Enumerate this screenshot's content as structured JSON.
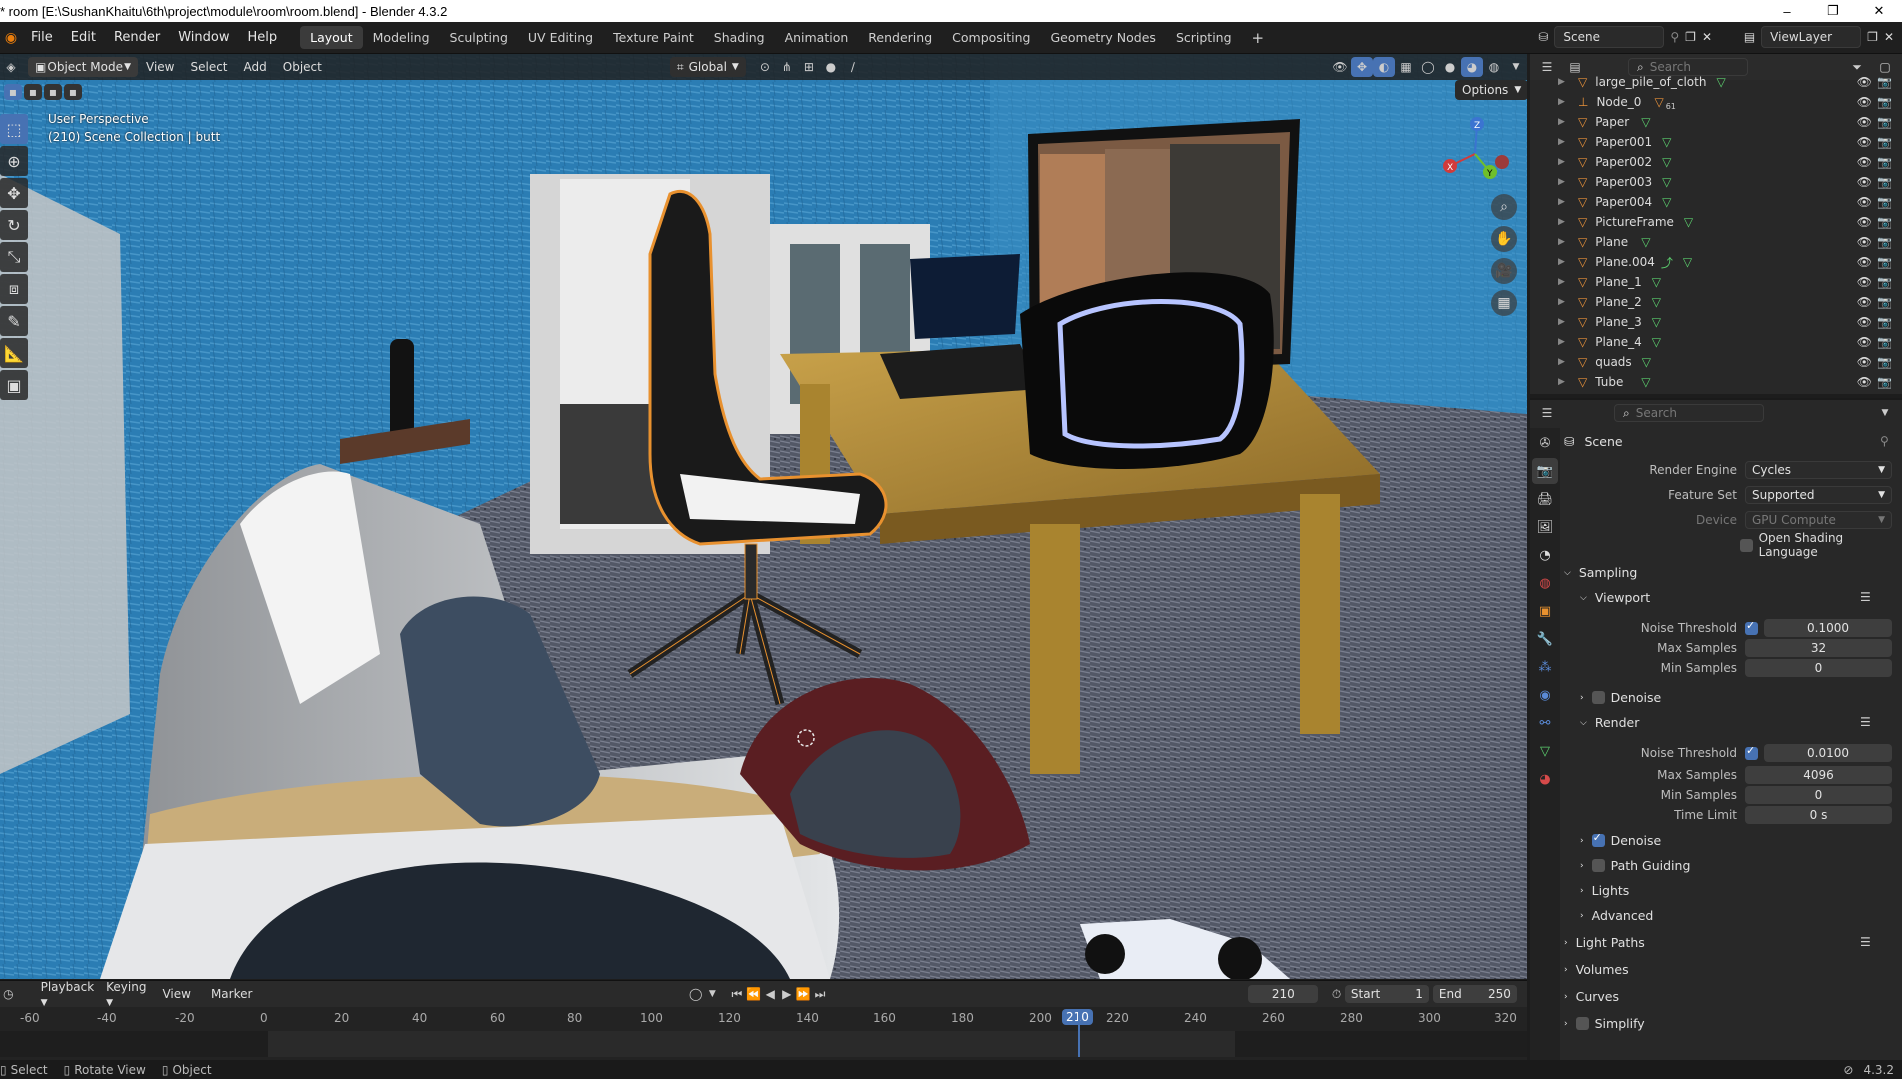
{
  "window": {
    "title": "* room [E:\\SushanKhaitu\\6th\\project\\module\\room\\room.blend] - Blender 4.3.2",
    "minimize": "–",
    "maximize": "❐",
    "close": "✕"
  },
  "menus": [
    "File",
    "Edit",
    "Render",
    "Window",
    "Help"
  ],
  "workspaces": [
    "Layout",
    "Modeling",
    "Sculpting",
    "UV Editing",
    "Texture Paint",
    "Shading",
    "Animation",
    "Rendering",
    "Compositing",
    "Geometry Nodes",
    "Scripting",
    "+"
  ],
  "active_workspace": "Layout",
  "scene_selector": "Scene",
  "view_layer": "ViewLayer",
  "viewport": {
    "mode": "Object Mode",
    "menus": [
      "View",
      "Select",
      "Add",
      "Object"
    ],
    "transform": "Global",
    "options": "Options",
    "overlay_line1": "User Perspective",
    "overlay_line2": "(210) Scene Collection | butt",
    "gizmo": {
      "x": "X",
      "y": "Y",
      "z": "Z"
    }
  },
  "outliner": {
    "search_placeholder": "Search",
    "items": [
      {
        "name": "large_pile_of_cloth",
        "extra": ""
      },
      {
        "name": "Node_0",
        "extra": "61"
      },
      {
        "name": "Paper",
        "extra": ""
      },
      {
        "name": "Paper001",
        "extra": ""
      },
      {
        "name": "Paper002",
        "extra": ""
      },
      {
        "name": "Paper003",
        "extra": ""
      },
      {
        "name": "Paper004",
        "extra": ""
      },
      {
        "name": "PictureFrame",
        "extra": ""
      },
      {
        "name": "Plane",
        "extra": ""
      },
      {
        "name": "Plane.004",
        "extra": ""
      },
      {
        "name": "Plane_1",
        "extra": ""
      },
      {
        "name": "Plane_2",
        "extra": ""
      },
      {
        "name": "Plane_3",
        "extra": ""
      },
      {
        "name": "Plane_4",
        "extra": ""
      },
      {
        "name": "quads",
        "extra": ""
      },
      {
        "name": "Tube",
        "extra": ""
      }
    ]
  },
  "properties": {
    "search_placeholder": "Search",
    "context": "Scene",
    "render_engine_label": "Render Engine",
    "render_engine": "Cycles",
    "feature_set_label": "Feature Set",
    "feature_set": "Supported",
    "device_label": "Device",
    "device": "GPU Compute",
    "osl": "Open Shading Language",
    "sampling": "Sampling",
    "viewport": "Viewport",
    "noise_threshold_label": "Noise Threshold",
    "vp_noise_threshold": "0.1000",
    "max_samples_label": "Max Samples",
    "vp_max_samples": "32",
    "min_samples_label": "Min Samples",
    "vp_min_samples": "0",
    "denoise": "Denoise",
    "render": "Render",
    "r_noise_threshold": "0.0100",
    "r_max_samples": "4096",
    "r_min_samples": "0",
    "time_limit_label": "Time Limit",
    "time_limit": "0 s",
    "path_guiding": "Path Guiding",
    "lights": "Lights",
    "advanced": "Advanced",
    "light_paths": "Light Paths",
    "volumes": "Volumes",
    "curves": "Curves",
    "simplify": "Simplify"
  },
  "timeline": {
    "menus": [
      "Playback",
      "Keying",
      "View",
      "Marker"
    ],
    "current_frame": "210",
    "start_label": "Start",
    "start": "1",
    "end_label": "End",
    "end": "250",
    "ticks": [
      "-60",
      "-40",
      "-20",
      "0",
      "20",
      "40",
      "60",
      "80",
      "100",
      "120",
      "140",
      "160",
      "180",
      "200",
      "210",
      "220",
      "240",
      "260",
      "280",
      "300",
      "320"
    ]
  },
  "statusbar": {
    "select": "Select",
    "rotate": "Rotate View",
    "object": "Object",
    "version": "4.3.2"
  },
  "colors": {
    "accent": "#4772b3",
    "selection_outline": "#e8912f",
    "wall_blue": "#2d7fb5"
  }
}
